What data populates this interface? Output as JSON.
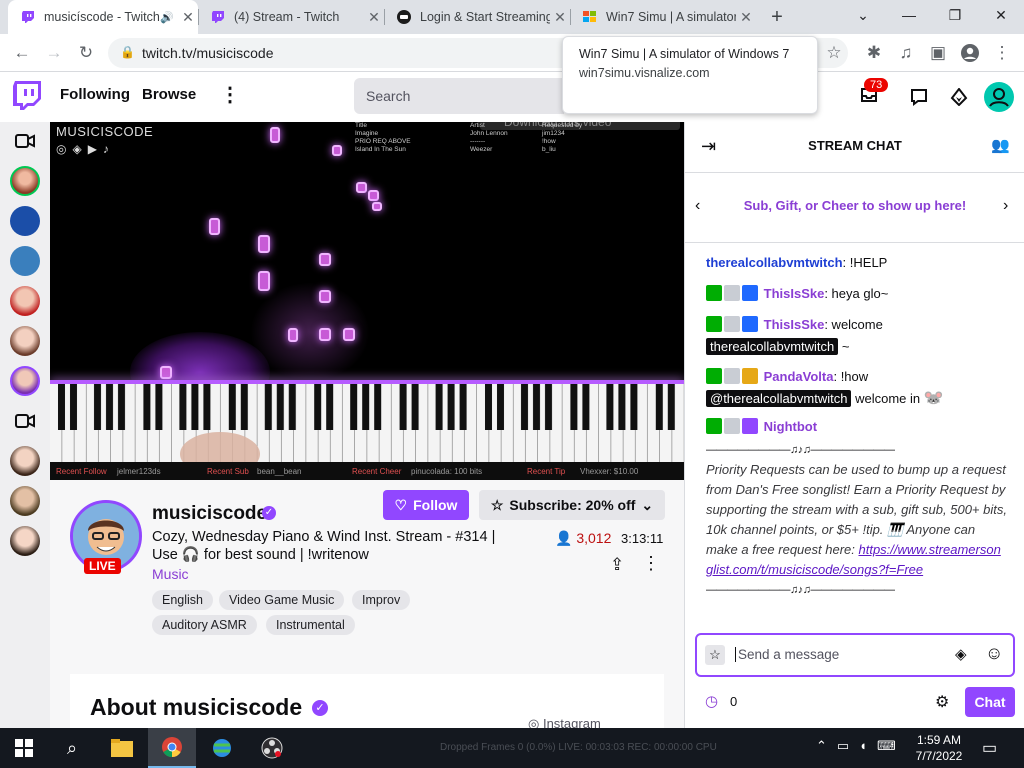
{
  "browser": {
    "tabs": [
      {
        "title": "musicíscode - Twitch"
      },
      {
        "title": "(4) Stream - Twitch"
      },
      {
        "title": "Login & Start Streaming"
      },
      {
        "title": "Win7 Simu | A simulator"
      }
    ],
    "new_tab": "+",
    "url": "twitch.tv/musiciscode",
    "tooltip": {
      "title": "Win7 Simu | A simulator of Windows 7",
      "url": "win7simu.visnalize.com"
    }
  },
  "twitch_nav": {
    "following": "Following",
    "browse": "Browse",
    "search_placeholder": "Search",
    "notif_count": "73"
  },
  "video": {
    "channel_watermark": "MUSICISCODE",
    "download_banner": "Download this video",
    "queue": [
      {
        "n": "#",
        "title": "Title",
        "artist": "Artist",
        "req": "Requested by"
      },
      {
        "n": "1",
        "title": "Imagine",
        "artist": "John Lennon",
        "req": "jim1234"
      },
      {
        "n": "2",
        "title": "PRIO REQ ABOVE",
        "artist": "-------",
        "req": "!how"
      },
      {
        "n": "3",
        "title": "Island In The Sun",
        "artist": "Weezer",
        "req": "b_liu"
      }
    ],
    "footer": [
      {
        "label": "Recent Follow",
        "value": "jelmer123ds"
      },
      {
        "label": "Recent Sub",
        "value": "bean__bean"
      },
      {
        "label": "Recent Cheer",
        "value": "pinucolada: 100 bits"
      },
      {
        "label": "Recent Tip",
        "value": "Vhexxer: $10.00"
      }
    ]
  },
  "channel": {
    "name": "musiciscode",
    "live": "LIVE",
    "title_line1": "Cozy, Wednesday Piano & Wind Inst. Stream - #314 |",
    "title_line2a": "Use",
    "title_line2b": "for best sound | !writenow",
    "category": "Music",
    "viewers": "3,012",
    "uptime": "3:13:11",
    "follow": "Follow",
    "subscribe": "Subscribe: 20% off",
    "tags": [
      "English",
      "Video Game Music",
      "Improv",
      "Auditory ASMR",
      "Instrumental"
    ],
    "about": "About musiciscode",
    "instagram": "Instagram"
  },
  "chat": {
    "header": "STREAM CHAT",
    "promo": "Sub, Gift, or Cheer to show up here!",
    "messages": [
      {
        "user": "therealcollabvmtwitch",
        "color": "#1e3fd4",
        "text": ": !HELP"
      },
      {
        "user": "ThisIsSke",
        "color": "#8a3ed4",
        "text": ": heya glo~"
      },
      {
        "user": "ThisIsSke",
        "color": "#8a3ed4",
        "text": ": welcome",
        "mention": "therealcollabvmtwitch",
        "tail": " ~"
      },
      {
        "user": "PandaVolta",
        "color": "#8a3ed4",
        "text": ": !how",
        "mention": "@therealcollabvmtwitch",
        "tail": " welcome in"
      },
      {
        "user": "Nightbot",
        "color": "#8a3ed4",
        "text": ""
      }
    ],
    "nightbot_rule": "————————♫♪♫————————",
    "nightbot_body": "Priority Requests can be used to bump up a request from Dan's Free songlist! Earn a Priority Request by supporting the stream with a sub, gift sub, 500+ bits, 10k channel points, or $5+ !tip.",
    "nightbot_body2": "Anyone can make a free request here:",
    "nightbot_link": "https://www.streamersonglist.com/t/musiciscode/songs?f=Free",
    "input_placeholder": "Send a message",
    "points": "0",
    "chat_button": "Chat"
  },
  "taskbar": {
    "time": "1:59 AM",
    "date": "7/7/2022",
    "obs_status": "Dropped Frames 0 (0.0%)   LIVE: 00:03:03   REC: 00:00:00   CPU"
  },
  "colors": {
    "twitch_purple": "#9147ff",
    "live_red": "#eb0400"
  }
}
